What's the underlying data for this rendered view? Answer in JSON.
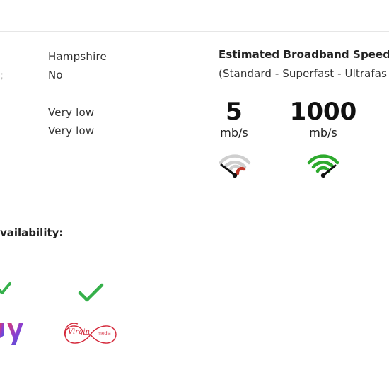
{
  "details": {
    "county": "Hampshire",
    "flag": "No",
    "risk_a": "Very low",
    "risk_b": "Very low"
  },
  "broadband": {
    "title": "Estimated Broadband Speeds",
    "subtitle": "(Standard - Superfast - Ultrafas",
    "standard": {
      "value": "5",
      "unit": "mb/s",
      "gauge_color": "#c0392b",
      "gauge_level": "low",
      "gauge_icon": "speedometer-low-icon"
    },
    "ultrafast": {
      "value": "1000",
      "unit": "mb/s",
      "gauge_color": "#2eaa2e",
      "gauge_level": "high",
      "gauge_icon": "speedometer-high-icon"
    }
  },
  "availability": {
    "heading_partial": "vailability:",
    "providers": [
      {
        "name": "sky",
        "available": true,
        "logo_text": "y",
        "icon": "check-icon"
      },
      {
        "name": "virgin-media",
        "available": true,
        "logo_text": "Virgin",
        "logo_subtext": "media",
        "icon": "check-icon"
      }
    ],
    "check_color": "#35b04a"
  },
  "colors": {
    "virgin_red": "#d4283a",
    "sky_purple": "#6b3fc9"
  }
}
